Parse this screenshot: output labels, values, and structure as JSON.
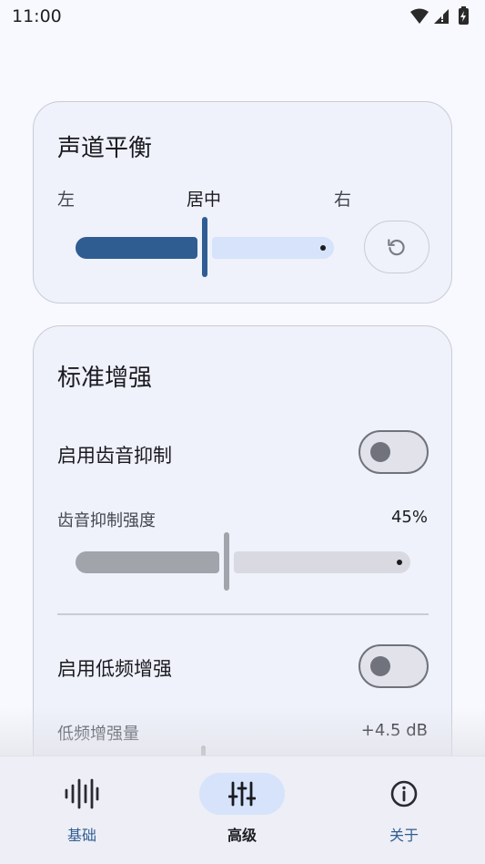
{
  "status": {
    "time": "11:00",
    "icons": [
      "wifi-icon",
      "signal-icon",
      "battery-charging-icon"
    ]
  },
  "balance": {
    "title": "声道平衡",
    "left_label": "左",
    "center_label": "居中",
    "right_label": "右",
    "value_fraction": 0.5,
    "reset_icon": "reset-icon"
  },
  "enhance": {
    "title": "标准增强",
    "deesser": {
      "label": "启用齿音抑制",
      "enabled": false,
      "strength_label": "齿音抑制强度",
      "strength_value": "45%",
      "strength_fraction": 0.45
    },
    "bass": {
      "label": "启用低频增强",
      "enabled": false,
      "amount_label": "低频增强量",
      "amount_value": "+4.5 dB"
    }
  },
  "nav": {
    "items": [
      {
        "label": "基础",
        "icon": "waveform-icon",
        "active": false
      },
      {
        "label": "高级",
        "icon": "equalizer-sliders-icon",
        "active": true
      },
      {
        "label": "关于",
        "icon": "info-icon",
        "active": false
      }
    ]
  },
  "colors": {
    "accent": "#2f5d92",
    "accent_light": "#d6e3fb",
    "disabled_fill": "#a2a4ab",
    "disabled_rest": "#d9dae1",
    "card_bg": "#eff1fb"
  }
}
